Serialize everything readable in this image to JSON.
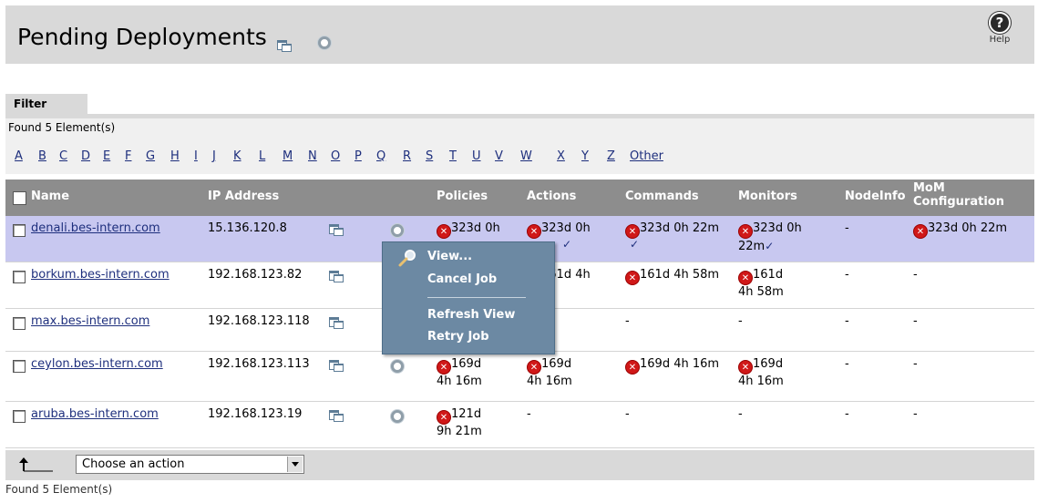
{
  "header": {
    "title": "Pending Deployments",
    "help_label": "Help",
    "help_glyph": "?"
  },
  "filter": {
    "tab_label": "Filter",
    "found_top": "Found 5 Element(s)",
    "letters": [
      "A",
      "B",
      "C",
      "D",
      "E",
      "F",
      "G",
      "H",
      "I",
      "J",
      "K",
      "L",
      "M",
      "N",
      "O",
      "P",
      "Q",
      "R",
      "S",
      "T",
      "U",
      "V",
      "W",
      "X",
      "Y",
      "Z",
      "Other"
    ]
  },
  "table": {
    "columns": {
      "name": "Name",
      "ip": "IP Address",
      "policies": "Policies",
      "actions": "Actions",
      "commands": "Commands",
      "monitors": "Monitors",
      "nodeinfo": "NodeInfo",
      "mom_line1": "MoM",
      "mom_line2": "Configuration"
    },
    "rows": [
      {
        "name": "denali.bes-intern.com",
        "ip": "15.136.120.8",
        "policies": "323d 0h",
        "actions": "323d 0h",
        "commands": "323d 0h 22m",
        "monitors": "323d 0h 22m",
        "nodeinfo": "-",
        "mom": "323d 0h 22m"
      },
      {
        "name": "borkum.bes-intern.com",
        "ip": "192.168.123.82",
        "policies": "",
        "actions": "161d 4h",
        "commands": "161d 4h 58m",
        "monitors": "161d 4h 58m",
        "nodeinfo": "-",
        "mom": "-"
      },
      {
        "name": "max.bes-intern.com",
        "ip": "192.168.123.118",
        "policies": "",
        "actions": "",
        "commands": "-",
        "monitors": "-",
        "nodeinfo": "-",
        "mom": "-"
      },
      {
        "name": "ceylon.bes-intern.com",
        "ip": "192.168.123.113",
        "policies": "169d 4h 16m",
        "actions": "169d 4h 16m",
        "commands": "169d 4h 16m",
        "monitors": "169d 4h 16m",
        "nodeinfo": "-",
        "mom": "-"
      },
      {
        "name": "aruba.bes-intern.com",
        "ip": "192.168.123.19",
        "policies": "121d 9h 21m",
        "actions": "-",
        "commands": "-",
        "monitors": "-",
        "nodeinfo": "-",
        "mom": "-"
      }
    ]
  },
  "context_menu": {
    "view": "View...",
    "cancel": "Cancel Job",
    "refresh": "Refresh View",
    "retry": "Retry Job"
  },
  "footer": {
    "action_select": "Choose an action",
    "found_bottom": "Found 5 Element(s)"
  },
  "glyphs": {
    "error": "✕",
    "check": "✓"
  },
  "colors": {
    "link": "#1e2f7d",
    "selected_row": "#c8c8f0",
    "menu_bg": "#6c89a3",
    "header_bg": "#8d8d8d",
    "error_red": "#d01818"
  }
}
